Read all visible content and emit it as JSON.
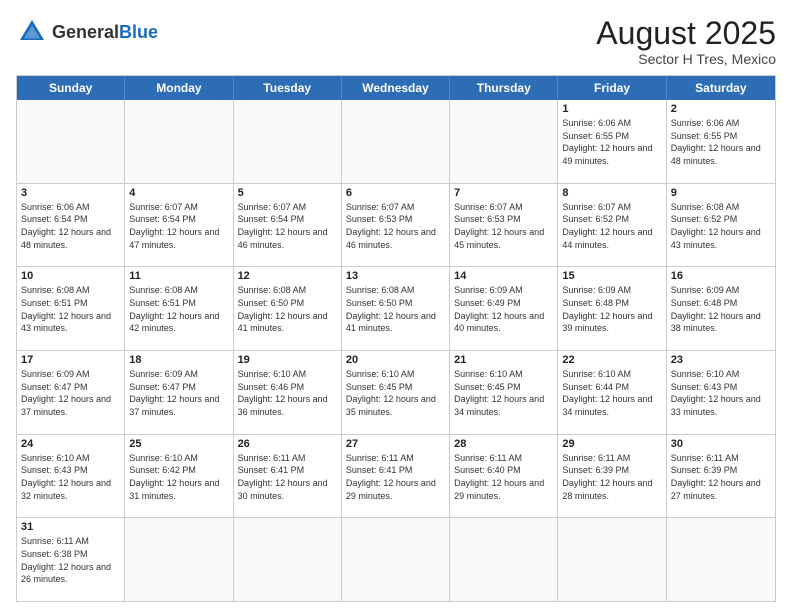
{
  "header": {
    "logo_general": "General",
    "logo_blue": "Blue",
    "month_title": "August 2025",
    "subtitle": "Sector H Tres, Mexico"
  },
  "calendar": {
    "days_of_week": [
      "Sunday",
      "Monday",
      "Tuesday",
      "Wednesday",
      "Thursday",
      "Friday",
      "Saturday"
    ],
    "weeks": [
      [
        {
          "day": "",
          "info": ""
        },
        {
          "day": "",
          "info": ""
        },
        {
          "day": "",
          "info": ""
        },
        {
          "day": "",
          "info": ""
        },
        {
          "day": "",
          "info": ""
        },
        {
          "day": "1",
          "info": "Sunrise: 6:06 AM\nSunset: 6:55 PM\nDaylight: 12 hours\nand 49 minutes."
        },
        {
          "day": "2",
          "info": "Sunrise: 6:06 AM\nSunset: 6:55 PM\nDaylight: 12 hours\nand 48 minutes."
        }
      ],
      [
        {
          "day": "3",
          "info": "Sunrise: 6:06 AM\nSunset: 6:54 PM\nDaylight: 12 hours\nand 48 minutes."
        },
        {
          "day": "4",
          "info": "Sunrise: 6:07 AM\nSunset: 6:54 PM\nDaylight: 12 hours\nand 47 minutes."
        },
        {
          "day": "5",
          "info": "Sunrise: 6:07 AM\nSunset: 6:54 PM\nDaylight: 12 hours\nand 46 minutes."
        },
        {
          "day": "6",
          "info": "Sunrise: 6:07 AM\nSunset: 6:53 PM\nDaylight: 12 hours\nand 46 minutes."
        },
        {
          "day": "7",
          "info": "Sunrise: 6:07 AM\nSunset: 6:53 PM\nDaylight: 12 hours\nand 45 minutes."
        },
        {
          "day": "8",
          "info": "Sunrise: 6:07 AM\nSunset: 6:52 PM\nDaylight: 12 hours\nand 44 minutes."
        },
        {
          "day": "9",
          "info": "Sunrise: 6:08 AM\nSunset: 6:52 PM\nDaylight: 12 hours\nand 43 minutes."
        }
      ],
      [
        {
          "day": "10",
          "info": "Sunrise: 6:08 AM\nSunset: 6:51 PM\nDaylight: 12 hours\nand 43 minutes."
        },
        {
          "day": "11",
          "info": "Sunrise: 6:08 AM\nSunset: 6:51 PM\nDaylight: 12 hours\nand 42 minutes."
        },
        {
          "day": "12",
          "info": "Sunrise: 6:08 AM\nSunset: 6:50 PM\nDaylight: 12 hours\nand 41 minutes."
        },
        {
          "day": "13",
          "info": "Sunrise: 6:08 AM\nSunset: 6:50 PM\nDaylight: 12 hours\nand 41 minutes."
        },
        {
          "day": "14",
          "info": "Sunrise: 6:09 AM\nSunset: 6:49 PM\nDaylight: 12 hours\nand 40 minutes."
        },
        {
          "day": "15",
          "info": "Sunrise: 6:09 AM\nSunset: 6:48 PM\nDaylight: 12 hours\nand 39 minutes."
        },
        {
          "day": "16",
          "info": "Sunrise: 6:09 AM\nSunset: 6:48 PM\nDaylight: 12 hours\nand 38 minutes."
        }
      ],
      [
        {
          "day": "17",
          "info": "Sunrise: 6:09 AM\nSunset: 6:47 PM\nDaylight: 12 hours\nand 37 minutes."
        },
        {
          "day": "18",
          "info": "Sunrise: 6:09 AM\nSunset: 6:47 PM\nDaylight: 12 hours\nand 37 minutes."
        },
        {
          "day": "19",
          "info": "Sunrise: 6:10 AM\nSunset: 6:46 PM\nDaylight: 12 hours\nand 36 minutes."
        },
        {
          "day": "20",
          "info": "Sunrise: 6:10 AM\nSunset: 6:45 PM\nDaylight: 12 hours\nand 35 minutes."
        },
        {
          "day": "21",
          "info": "Sunrise: 6:10 AM\nSunset: 6:45 PM\nDaylight: 12 hours\nand 34 minutes."
        },
        {
          "day": "22",
          "info": "Sunrise: 6:10 AM\nSunset: 6:44 PM\nDaylight: 12 hours\nand 34 minutes."
        },
        {
          "day": "23",
          "info": "Sunrise: 6:10 AM\nSunset: 6:43 PM\nDaylight: 12 hours\nand 33 minutes."
        }
      ],
      [
        {
          "day": "24",
          "info": "Sunrise: 6:10 AM\nSunset: 6:43 PM\nDaylight: 12 hours\nand 32 minutes."
        },
        {
          "day": "25",
          "info": "Sunrise: 6:10 AM\nSunset: 6:42 PM\nDaylight: 12 hours\nand 31 minutes."
        },
        {
          "day": "26",
          "info": "Sunrise: 6:11 AM\nSunset: 6:41 PM\nDaylight: 12 hours\nand 30 minutes."
        },
        {
          "day": "27",
          "info": "Sunrise: 6:11 AM\nSunset: 6:41 PM\nDaylight: 12 hours\nand 29 minutes."
        },
        {
          "day": "28",
          "info": "Sunrise: 6:11 AM\nSunset: 6:40 PM\nDaylight: 12 hours\nand 29 minutes."
        },
        {
          "day": "29",
          "info": "Sunrise: 6:11 AM\nSunset: 6:39 PM\nDaylight: 12 hours\nand 28 minutes."
        },
        {
          "day": "30",
          "info": "Sunrise: 6:11 AM\nSunset: 6:39 PM\nDaylight: 12 hours\nand 27 minutes."
        }
      ],
      [
        {
          "day": "31",
          "info": "Sunrise: 6:11 AM\nSunset: 6:38 PM\nDaylight: 12 hours\nand 26 minutes."
        },
        {
          "day": "",
          "info": ""
        },
        {
          "day": "",
          "info": ""
        },
        {
          "day": "",
          "info": ""
        },
        {
          "day": "",
          "info": ""
        },
        {
          "day": "",
          "info": ""
        },
        {
          "day": "",
          "info": ""
        }
      ]
    ]
  }
}
